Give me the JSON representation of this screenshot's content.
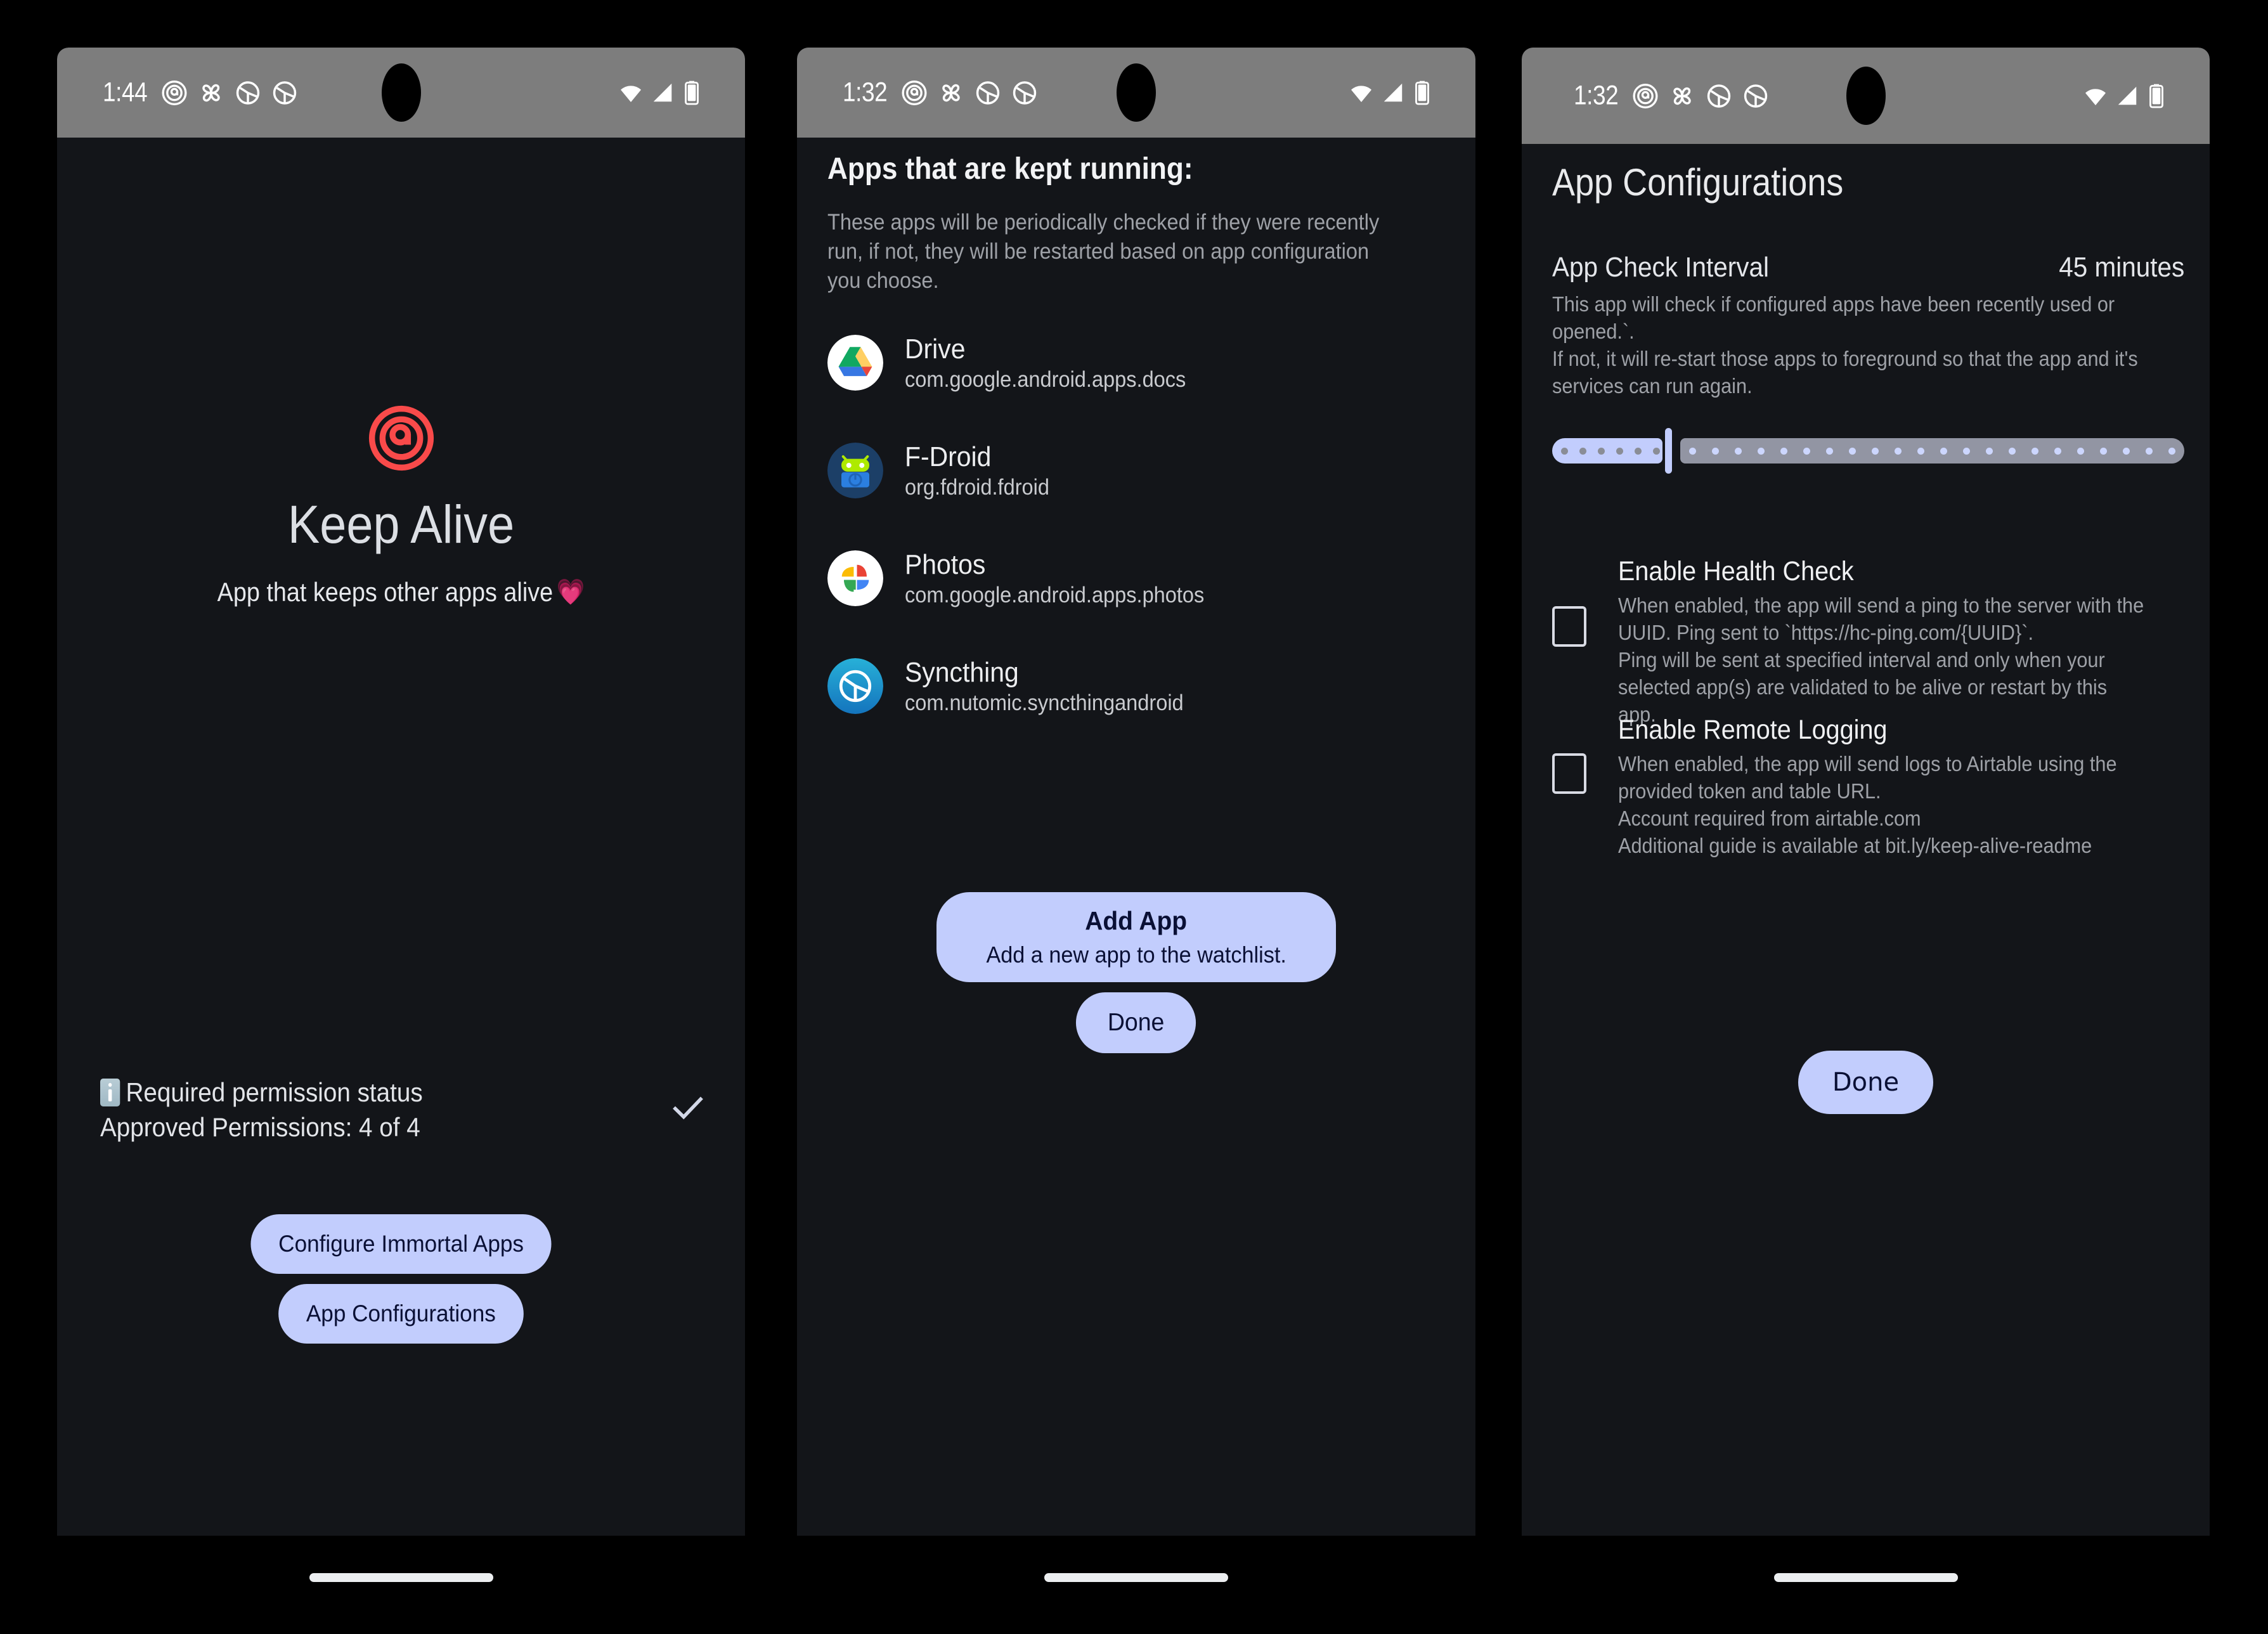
{
  "statusbar": {
    "time_1": "1:44",
    "time_2": "1:32",
    "time_3": "1:32",
    "icons": [
      "at-icon",
      "pinwheel-icon",
      "syncthing-icon",
      "syncthing-icon"
    ],
    "right_icons": [
      "wifi-icon",
      "signal-icon",
      "battery-icon"
    ]
  },
  "panel1": {
    "app_title": "Keep Alive",
    "tagline": "App that keeps other apps alive",
    "tagline_emoji": "💗",
    "permission_heading": "Required permission status",
    "permission_count": "Approved Permissions: 4 of 4",
    "info_icon": "info-icon",
    "status_icon": "check-icon",
    "buttons": [
      {
        "label": "Configure Immortal Apps"
      },
      {
        "label": "App Configurations"
      }
    ]
  },
  "panel2": {
    "title": "Apps that are kept running:",
    "description": "These apps will be periodically checked if they were recently run, if not, they will be restarted based on app configuration you choose.",
    "apps": [
      {
        "name": "Drive",
        "package": "com.google.android.apps.docs",
        "icon": "google-drive-icon"
      },
      {
        "name": "F-Droid",
        "package": "org.fdroid.fdroid",
        "icon": "f-droid-icon"
      },
      {
        "name": "Photos",
        "package": "com.google.android.apps.photos",
        "icon": "google-photos-icon"
      },
      {
        "name": "Syncthing",
        "package": "com.nutomic.syncthingandroid",
        "icon": "syncthing-icon"
      }
    ],
    "add_app_title": "Add App",
    "add_app_sub": "Add a new app to the watchlist.",
    "done_label": "Done"
  },
  "panel3": {
    "title": "App Configurations",
    "interval_label": "App Check Interval",
    "interval_value": "45 minutes",
    "interval_desc_line1": "This app will check if configured apps have been recently used or opened.`.",
    "interval_desc_line2": "If not, it will re-start those apps to foreground so that the app and it's services can run again.",
    "slider": {
      "active_ticks": 6,
      "inactive_ticks": 22,
      "value_percent": 12
    },
    "health_check": {
      "title": "Enable Health Check",
      "desc_line1": "When enabled, the app will send a ping to the server with the UUID. Ping sent to `https://hc-ping.com/{UUID}`.",
      "desc_line2": "Ping will be sent at specified interval and only when your selected app(s) are validated to be alive or restart by this app.",
      "checked": false
    },
    "remote_logging": {
      "title": "Enable Remote Logging",
      "desc_line1": "When enabled, the app will send logs to Airtable using the provided token and table URL.",
      "desc_line2": "Account required from airtable.com",
      "desc_line3": "Additional guide is available at bit.ly/keep-alive-readme",
      "checked": false
    },
    "done_label": "Done"
  },
  "colors": {
    "background": "#000000",
    "screen": "#131519",
    "statusbar": "#7d7d7d",
    "accent": "#c2cdfd",
    "accent_text": "#0a1035",
    "logo": "#f94a4a",
    "heart": "#f73b8e",
    "muted_text": "#9ea1a7",
    "primary_text": "#e9eaec"
  }
}
